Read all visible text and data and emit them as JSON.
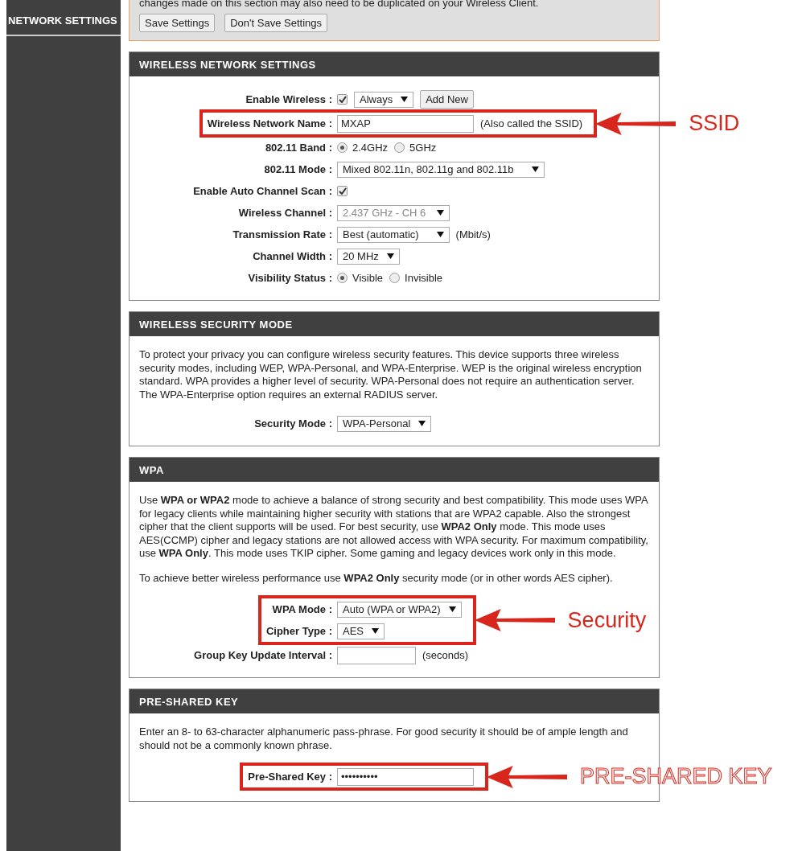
{
  "sidebar": {
    "items": [
      {
        "label": "NETWORK SETTINGS",
        "selected": true
      }
    ]
  },
  "notice": {
    "text": "changes made on this section may also need to be duplicated on your Wireless Client.",
    "buttons": [
      {
        "label": "Save Settings"
      },
      {
        "label": "Don't Save Settings"
      }
    ]
  },
  "sections": [
    {
      "title": "WIRELESS NETWORK SETTINGS",
      "blocks": [
        {
          "kind": "row",
          "label": "Enable Wireless :",
          "controls": [
            {
              "kind": "checkbox",
              "checked": true
            },
            {
              "kind": "select",
              "value": "Always",
              "disabled": false
            },
            {
              "kind": "button",
              "label": "Add New"
            }
          ]
        },
        {
          "kind": "highlight",
          "callout": "SSID",
          "outlined": false,
          "rows": [
            {
              "label": "Wireless Network Name :",
              "controls": [
                {
                  "kind": "text",
                  "value": "MXAP"
                },
                {
                  "kind": "note",
                  "text": "(Also called the SSID)"
                }
              ]
            }
          ]
        },
        {
          "kind": "row",
          "label": "802.11 Band :",
          "controls": [
            {
              "kind": "radio",
              "label": "2.4GHz",
              "selected": true
            },
            {
              "kind": "radio",
              "label": "5GHz",
              "selected": false
            }
          ]
        },
        {
          "kind": "row",
          "label": "802.11 Mode :",
          "controls": [
            {
              "kind": "select",
              "value": "Mixed 802.11n, 802.11g and 802.11b",
              "disabled": false
            }
          ]
        },
        {
          "kind": "row",
          "label": "Enable Auto Channel Scan :",
          "controls": [
            {
              "kind": "checkbox",
              "checked": true
            }
          ]
        },
        {
          "kind": "row",
          "label": "Wireless Channel :",
          "controls": [
            {
              "kind": "select",
              "value": "2.437 GHz - CH 6",
              "disabled": true
            }
          ]
        },
        {
          "kind": "row",
          "label": "Transmission Rate :",
          "controls": [
            {
              "kind": "select",
              "value": "Best (automatic)",
              "disabled": false
            },
            {
              "kind": "note",
              "text": "(Mbit/s)"
            }
          ]
        },
        {
          "kind": "row",
          "label": "Channel Width :",
          "controls": [
            {
              "kind": "select",
              "value": "20 MHz",
              "disabled": false
            }
          ]
        },
        {
          "kind": "row",
          "label": "Visibility Status :",
          "controls": [
            {
              "kind": "radio",
              "label": "Visible",
              "selected": true
            },
            {
              "kind": "radio",
              "label": "Invisible",
              "selected": false
            }
          ]
        }
      ]
    },
    {
      "title": "WIRELESS SECURITY MODE",
      "blocks": [
        {
          "kind": "paragraph",
          "text": "To protect your privacy you can configure wireless security features. This device supports three wireless security modes, including WEP, WPA-Personal, and WPA-Enterprise. WEP is the original wireless encryption standard. WPA provides a higher level of security. WPA-Personal does not require an authentication server. The WPA-Enterprise option requires an external RADIUS server."
        },
        {
          "kind": "row",
          "label": "Security Mode :",
          "controls": [
            {
              "kind": "select",
              "value": "WPA-Personal",
              "disabled": false
            }
          ]
        }
      ]
    },
    {
      "title": "WPA",
      "blocks": [
        {
          "kind": "paragraph",
          "text": "Use **WPA or WPA2** mode to achieve a balance of strong security and best compatibility. This mode uses WPA for legacy clients while maintaining higher security with stations that are WPA2 capable. Also the strongest cipher that the client supports will be used. For best security, use **WPA2 Only** mode. This mode uses AES(CCMP) cipher and legacy stations are not allowed access with WPA security. For maximum compatibility, use **WPA Only**. This mode uses TKIP cipher. Some gaming and legacy devices work only in this mode."
        },
        {
          "kind": "paragraph",
          "text": "To achieve better wireless performance use **WPA2 Only** security mode (or in other words AES cipher)."
        },
        {
          "kind": "highlight",
          "callout": "Security",
          "outlined": false,
          "rows": [
            {
              "label": "WPA Mode :",
              "controls": [
                {
                  "kind": "select",
                  "value": "Auto (WPA or WPA2)",
                  "disabled": false
                }
              ]
            },
            {
              "label": "Cipher Type :",
              "controls": [
                {
                  "kind": "select",
                  "value": "AES",
                  "disabled": false
                }
              ]
            }
          ]
        },
        {
          "kind": "row",
          "label": "Group Key Update Interval :",
          "controls": [
            {
              "kind": "text"
            },
            {
              "kind": "note",
              "text": "(seconds)"
            }
          ]
        }
      ]
    },
    {
      "title": "PRE-SHARED KEY",
      "blocks": [
        {
          "kind": "paragraph",
          "text": "Enter an 8- to 63-character alphanumeric pass-phrase. For good security it should be of ample length and should not be a commonly known phrase."
        },
        {
          "kind": "highlight",
          "callout": "PRE-SHARED KEY",
          "outlined": true,
          "rows": [
            {
              "label": "Pre-Shared Key :",
              "controls": [
                {
                  "kind": "text",
                  "value": "••••••••••"
                }
              ]
            }
          ]
        }
      ]
    }
  ]
}
